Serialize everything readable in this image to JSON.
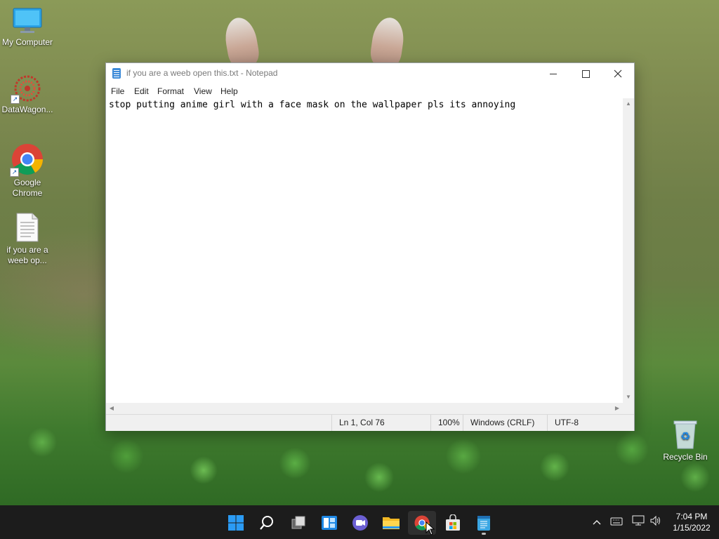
{
  "desktop": {
    "icons": [
      {
        "label": "My Computer",
        "icon": "monitor-icon"
      },
      {
        "label": "DataWagon...",
        "icon": "datawagon-icon"
      },
      {
        "label": "Google Chrome",
        "icon": "chrome-icon"
      },
      {
        "label": "if you are a weeb op...",
        "icon": "text-file-icon"
      },
      {
        "label": "Recycle Bin",
        "icon": "recycle-bin-icon"
      }
    ]
  },
  "notepad": {
    "title": "if you are a weeb open this.txt - Notepad",
    "menu": [
      "File",
      "Edit",
      "Format",
      "View",
      "Help"
    ],
    "content": "stop putting anime girl with a face mask on the wallpaper pls its annoying",
    "status": {
      "position": "Ln 1, Col 76",
      "zoom": "100%",
      "line_ending": "Windows (CRLF)",
      "encoding": "UTF-8"
    }
  },
  "taskbar": {
    "apps": [
      "start-icon",
      "search-icon",
      "task-view-icon",
      "widgets-icon",
      "teams-chat-icon",
      "file-explorer-icon",
      "chrome-icon",
      "store-icon",
      "notepad-icon"
    ],
    "clock": {
      "time": "7:04 PM",
      "date": "1/15/2022"
    }
  }
}
